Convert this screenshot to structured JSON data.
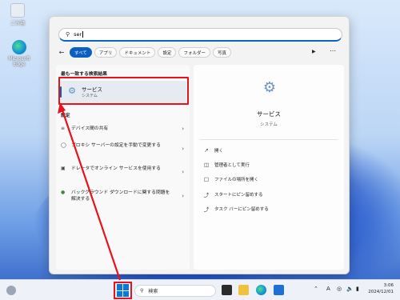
{
  "desktop": {
    "icons": [
      {
        "label": "ごみ箱",
        "icon": "recycle-bin-icon"
      },
      {
        "label": "Microsoft Edge",
        "icon": "edge-icon"
      }
    ]
  },
  "search": {
    "query": "ser"
  },
  "filters": {
    "back_icon": "arrow-left-icon",
    "chips": [
      "すべて",
      "アプリ",
      "ドキュメント",
      "設定",
      "フォルダー",
      "写真"
    ],
    "active_index": 0,
    "play_icon": "play-icon",
    "more_icon": "ellipsis-icon"
  },
  "results": {
    "best_heading": "最も一致する検索結果",
    "best": {
      "name": "サービス",
      "sub": "システム"
    },
    "settings_heading": "設定",
    "settings": [
      {
        "label": "デバイス間の共有",
        "icon": "share-icon"
      },
      {
        "label": "プロキシ サーバーの設定を手動で変更する",
        "icon": "proxy-icon"
      },
      {
        "label": "ドレータでオンライン サービスを使用する",
        "icon": "online-service-icon"
      },
      {
        "label": "バックグラウンド ダウンロードに関する問題を解決する",
        "icon": "download-icon"
      }
    ]
  },
  "preview": {
    "title": "サービス",
    "subtitle": "システム",
    "actions": [
      {
        "label": "開く",
        "icon": "open-icon"
      },
      {
        "label": "管理者として実行",
        "icon": "admin-icon"
      },
      {
        "label": "ファイルの場所を開く",
        "icon": "folder-icon"
      },
      {
        "label": "スタートにピン留めする",
        "icon": "pin-icon"
      },
      {
        "label": "タスク バーにピン留めする",
        "icon": "pin-icon"
      }
    ]
  },
  "taskbar": {
    "search_label": "検索",
    "clock_time": "3:06",
    "clock_date": "2024/12/01",
    "ime_label": "A"
  },
  "colors": {
    "accent": "#0a5fc2",
    "highlight": "#e8121c"
  }
}
